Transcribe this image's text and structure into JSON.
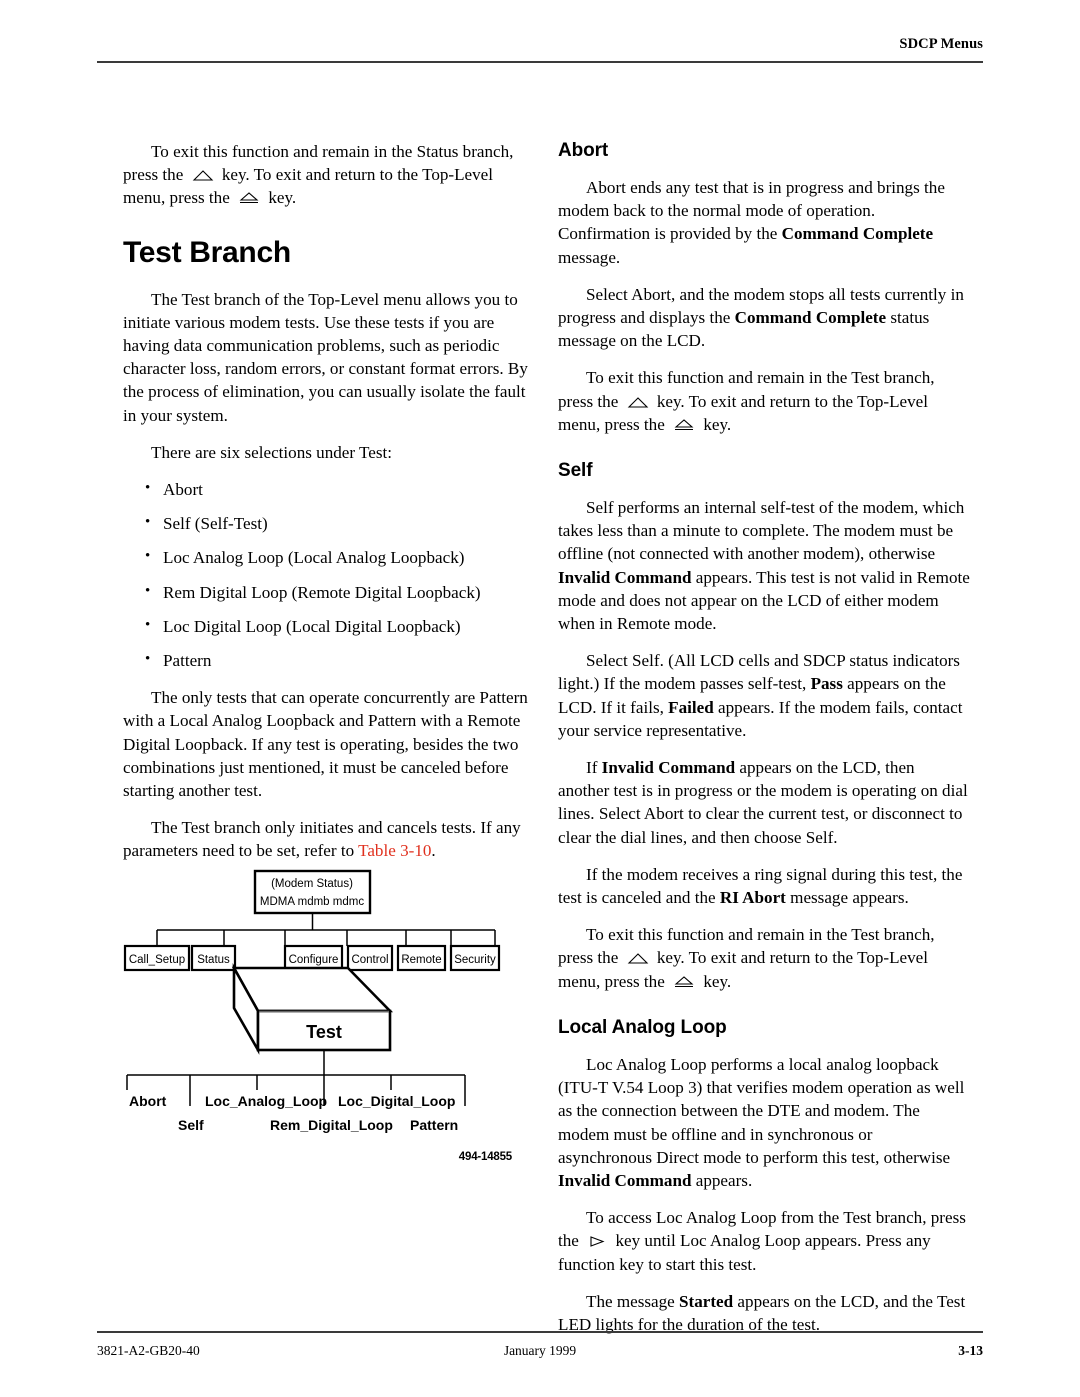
{
  "header": {
    "title": "SDCP Menus"
  },
  "footer": {
    "doc_number": "3821-A2-GB20-40",
    "date": "January 1999",
    "page_number": "3-13"
  },
  "left_column": {
    "intro_paragraph": {
      "part1": "To exit this function and remain in the Status branch, press the ",
      "part2": " key. To exit and return to the Top-Level menu, press the ",
      "part3": " key."
    },
    "branch_heading": "Test Branch",
    "para_overview": "The Test branch of the Top-Level menu allows you to initiate various modem tests. Use these tests if you are having data communication problems, such as periodic character loss, random errors, or constant format errors. By the process of elimination, you can usually isolate the fault in your system.",
    "para_selections_lead": "There are six selections under Test:",
    "bullet_marker": "•",
    "selections": [
      "Abort",
      "Self (Self-Test)",
      "Loc Analog Loop (Local Analog Loopback)",
      "Rem Digital Loop (Remote Digital Loopback)",
      "Loc Digital Loop (Local Digital Loopback)",
      "Pattern"
    ],
    "para_concurrent": "The only tests that can operate concurrently are Pattern with a Local Analog Loopback and Pattern with a Remote Digital Loopback. If any test is operating, besides the two combinations just mentioned, it must be canceled before starting another test.",
    "para_table_ref": {
      "part1": "The Test branch only initiates and cancels tests. If any parameters need to be set, refer to ",
      "link": "Table 3-10",
      "part2": "."
    }
  },
  "figure": {
    "id": "494-14855",
    "root_box": {
      "line1": "(Modem Status)",
      "line2": "MDMA  mdmb  mdmc"
    },
    "level1_boxes": [
      "Call_Setup",
      "Status",
      "Configure",
      "Control",
      "Remote",
      "Security"
    ],
    "highlight_box": "Test",
    "leaf_labels_top": [
      "Abort",
      "Loc_Analog_Loop",
      "Loc_Digital_Loop"
    ],
    "leaf_labels_bottom": [
      "Self",
      "Rem_Digital_Loop",
      "Pattern"
    ]
  },
  "right_column": {
    "abort": {
      "heading": "Abort",
      "para1_a": "Abort ends any test that is in progress and brings the modem back to the normal mode of operation. Confirmation is provided by the ",
      "para1_bold": "Command Complete",
      "para1_b": " message.",
      "para2_a": "Select Abort, and the modem stops all tests currently in progress and displays the ",
      "para2_bold": "Command Complete",
      "para2_b": " status message on the LCD.",
      "para3_a": "To exit this function and remain in the Test branch, press the ",
      "para3_b": " key. To exit and return to the Top-Level menu, press the ",
      "para3_c": " key."
    },
    "self": {
      "heading": "Self",
      "para1_a": "Self performs an internal self-test of the modem, which takes less than a minute to complete. The modem must be offline (not connected with another modem), otherwise ",
      "para1_bold": "Invalid Command",
      "para1_b": " appears. This test is not valid in Remote mode and does not appear on the LCD of either modem when in Remote mode.",
      "para2_a": "Select Self. (All LCD cells and SDCP status indicators light.) If the modem passes self-test, ",
      "para2_bold1": "Pass",
      "para2_b": " appears on the LCD. If it fails, ",
      "para2_bold2": "Failed",
      "para2_c": " appears. If the modem fails, contact your service representative.",
      "para3_a": "If ",
      "para3_bold": "Invalid Command",
      "para3_b": " appears on the LCD, then another test is in progress or the modem is operating on dial lines. Select Abort to clear the current test, or disconnect to clear the dial lines, and then choose Self.",
      "para4_a": "If the modem receives a ring signal during this test, the test is canceled and the ",
      "para4_bold": "RI Abort",
      "para4_b": " message appears.",
      "para5_a": "To exit this function and remain in the Test branch, press the ",
      "para5_b": " key. To exit and return to the Top-Level menu, press the ",
      "para5_c": " key."
    },
    "local_analog_loop": {
      "heading": "Local Analog Loop",
      "para1_a": "Loc Analog Loop performs a local analog loopback (ITU-T V.54 Loop 3) that verifies modem operation as well as the connection between the DTE and modem. The modem must be offline and in synchronous or asynchronous Direct mode to perform this test, otherwise ",
      "para1_bold": "Invalid Command",
      "para1_b": " appears.",
      "para2_a": "To access Loc Analog Loop from the Test branch, press the ",
      "para2_b": " key until Loc Analog Loop appears. Press any function key to start this test.",
      "para3_a": "The message ",
      "para3_bold": "Started",
      "para3_b": " appears on the LCD, and the Test LED lights for the duration of the test."
    }
  }
}
